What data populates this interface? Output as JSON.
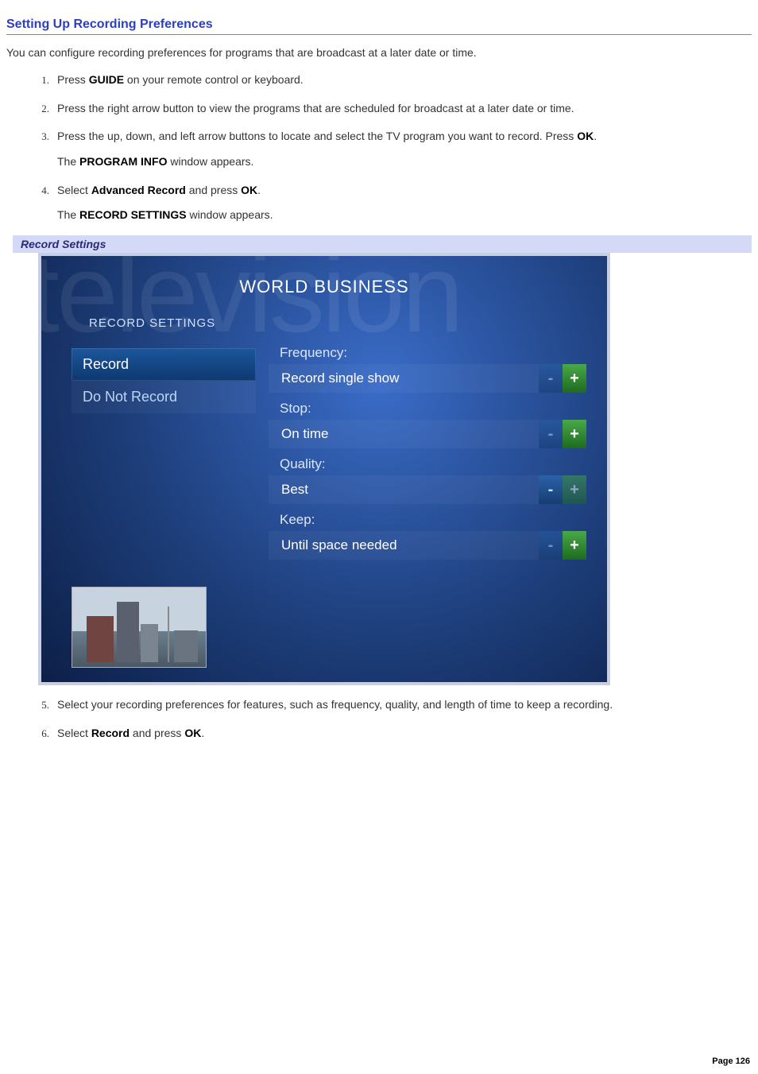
{
  "heading": "Setting Up Recording Preferences",
  "intro": "You can configure recording preferences for programs that are broadcast at a later date or time.",
  "steps": [
    {
      "num": "1.",
      "prefix": "Press ",
      "bold1": "GUIDE",
      "rest": " on your remote control or keyboard."
    },
    {
      "num": "2.",
      "prefix": "",
      "bold1": "",
      "rest": "Press the right arrow button to view the programs that are scheduled for broadcast at a later date or time."
    },
    {
      "num": "3.",
      "prefix": "Press the up, down, and left arrow buttons to locate and select the TV program you want to record. Press ",
      "bold1": "OK",
      "rest": ".",
      "sub_prefix": "The ",
      "sub_bold": "PROGRAM INFO",
      "sub_rest": " window appears."
    },
    {
      "num": "4.",
      "prefix": "Select ",
      "bold1": "Advanced Record",
      "mid": " and press ",
      "bold2": "OK",
      "rest": ".",
      "sub_prefix": "The ",
      "sub_bold": "RECORD SETTINGS",
      "sub_rest": " window appears."
    },
    {
      "num": "5.",
      "prefix": "",
      "bold1": "",
      "rest": "Select your recording preferences for features, such as frequency, quality, and length of time to keep a recording."
    },
    {
      "num": "6.",
      "prefix": "Select ",
      "bold1": "Record",
      "mid": " and press ",
      "bold2": "OK",
      "rest": "."
    }
  ],
  "panel_caption": "Record Settings",
  "tv": {
    "watermark": "television",
    "program_title": "WORLD BUSINESS",
    "screen_label": "RECORD SETTINGS",
    "menu": [
      {
        "label": "Record",
        "selected": true
      },
      {
        "label": "Do Not Record",
        "selected": false
      }
    ],
    "fields": [
      {
        "label": "Frequency:",
        "value": "Record single show",
        "minus_dim": true,
        "plus_dim": false
      },
      {
        "label": "Stop:",
        "value": "On time",
        "minus_dim": true,
        "plus_dim": false
      },
      {
        "label": "Quality:",
        "value": "Best",
        "minus_dim": false,
        "plus_dim": true
      },
      {
        "label": "Keep:",
        "value": "Until space needed",
        "minus_dim": true,
        "plus_dim": false
      }
    ]
  },
  "page_footer": "Page 126",
  "glyphs": {
    "minus": "-",
    "plus": "+"
  }
}
